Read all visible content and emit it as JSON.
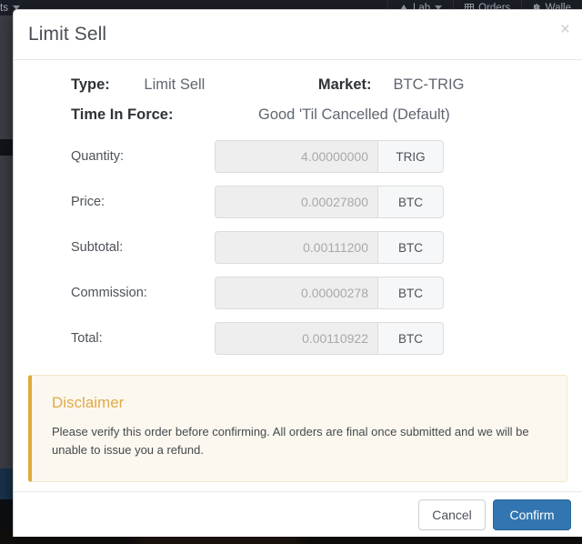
{
  "background": {
    "nav_left": [
      {
        "label": "ts",
        "icon": "chevron-down-icon"
      }
    ],
    "nav_right": [
      {
        "label": "Lab",
        "icon": "triangle-icon",
        "caret": true
      },
      {
        "label": "Orders",
        "icon": "grid-icon",
        "caret": false
      },
      {
        "label": "Walle",
        "icon": "bitcoin-icon",
        "caret": false
      }
    ]
  },
  "modal": {
    "title": "Limit Sell",
    "close_label": "×",
    "summary": {
      "type_label": "Type:",
      "type_value": "Limit Sell",
      "market_label": "Market:",
      "market_value": "BTC-TRIG",
      "tif_label": "Time In Force:",
      "tif_value": "Good 'Til Cancelled (Default)"
    },
    "fields": [
      {
        "label": "Quantity:",
        "value": "4.00000000",
        "unit": "TRIG"
      },
      {
        "label": "Price:",
        "value": "0.00027800",
        "unit": "BTC"
      },
      {
        "label": "Subtotal:",
        "value": "0.00111200",
        "unit": "BTC"
      },
      {
        "label": "Commission:",
        "value": "0.00000278",
        "unit": "BTC"
      },
      {
        "label": "Total:",
        "value": "0.00110922",
        "unit": "BTC"
      }
    ],
    "disclaimer": {
      "title": "Disclaimer",
      "text": "Please verify this order before confirming. All orders are final once submitted and we will be unable to issue you a refund."
    },
    "footer": {
      "cancel_label": "Cancel",
      "confirm_label": "Confirm"
    }
  },
  "colors": {
    "confirm_blue": "#3276b1",
    "disclaimer_border": "#dfa93c",
    "disclaimer_bg": "#fcf8ef",
    "disclaimer_title": "#dfaa4b"
  }
}
